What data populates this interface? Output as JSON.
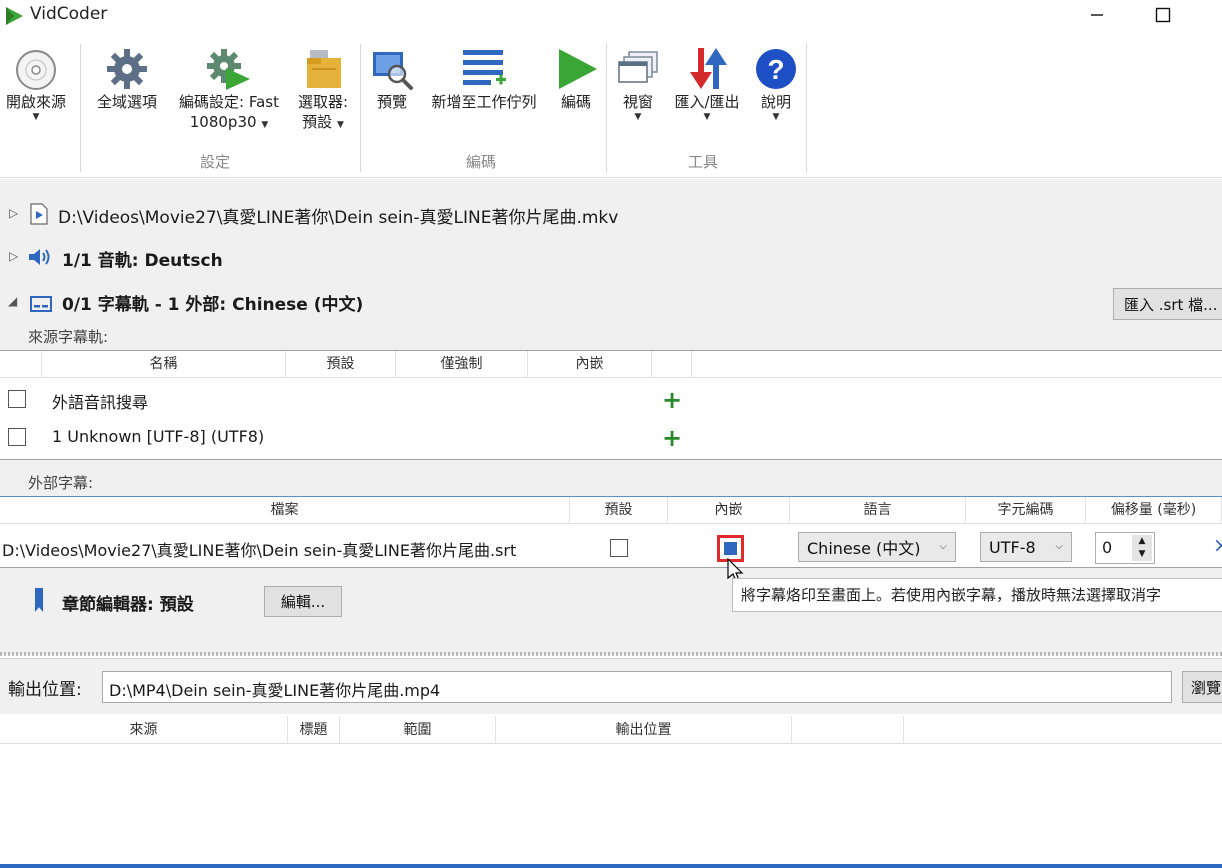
{
  "app": {
    "title": "VidCoder"
  },
  "ribbon": {
    "open_source": "開啟來源",
    "global_options": "全域選項",
    "encode_settings_line1": "編碼設定: Fast",
    "encode_settings_line2": "1080p30",
    "picker_line1": "選取器:",
    "picker_line2": "預設",
    "preview": "預覽",
    "add_to_queue": "新增至工作佇列",
    "encode": "編碼",
    "windows": "視窗",
    "import_export": "匯入/匯出",
    "help": "說明",
    "group_settings": "設定",
    "group_encode": "編碼",
    "group_tools": "工具"
  },
  "source": {
    "file_path": "D:\\Videos\\Movie27\\真愛LINE著你\\Dein sein-真愛LINE著你片尾曲.mkv",
    "audio_summary": "1/1 音軌: Deutsch",
    "subtitle_summary": "0/1 字幕軌 - 1 外部: Chinese (中文)",
    "import_srt_label": "匯入 .srt 檔..."
  },
  "source_subs": {
    "section_label": "來源字幕軌:",
    "columns": [
      "名稱",
      "預設",
      "僅強制",
      "內嵌"
    ],
    "rows": [
      {
        "name": "外語音訊搜尋"
      },
      {
        "name": "1 Unknown [UTF-8] (UTF8)"
      }
    ]
  },
  "external_subs": {
    "section_label": "外部字幕:",
    "columns": [
      "檔案",
      "預設",
      "內嵌",
      "語言",
      "字元編碼",
      "偏移量 (毫秒)"
    ],
    "row": {
      "file": "D:\\Videos\\Movie27\\真愛LINE著你\\Dein sein-真愛LINE著你片尾曲.srt",
      "language": "Chinese (中文)",
      "encoding": "UTF-8",
      "offset": "0"
    }
  },
  "chapters": {
    "label": "章節編輯器: 預設",
    "edit_button": "編輯..."
  },
  "tooltip": {
    "text": "將字幕烙印至畫面上。若使用內嵌字幕，播放時無法選擇取消字"
  },
  "output": {
    "label": "輸出位置:",
    "path": "D:\\MP4\\Dein sein-真愛LINE著你片尾曲.mp4",
    "browse_label": "瀏覽"
  },
  "queue": {
    "columns": [
      "來源",
      "標題",
      "範圍",
      "輸出位置"
    ]
  },
  "colors": {
    "accent_blue": "#1e6fd9",
    "play_green": "#3aa635",
    "highlight_red": "#e02b2b"
  }
}
